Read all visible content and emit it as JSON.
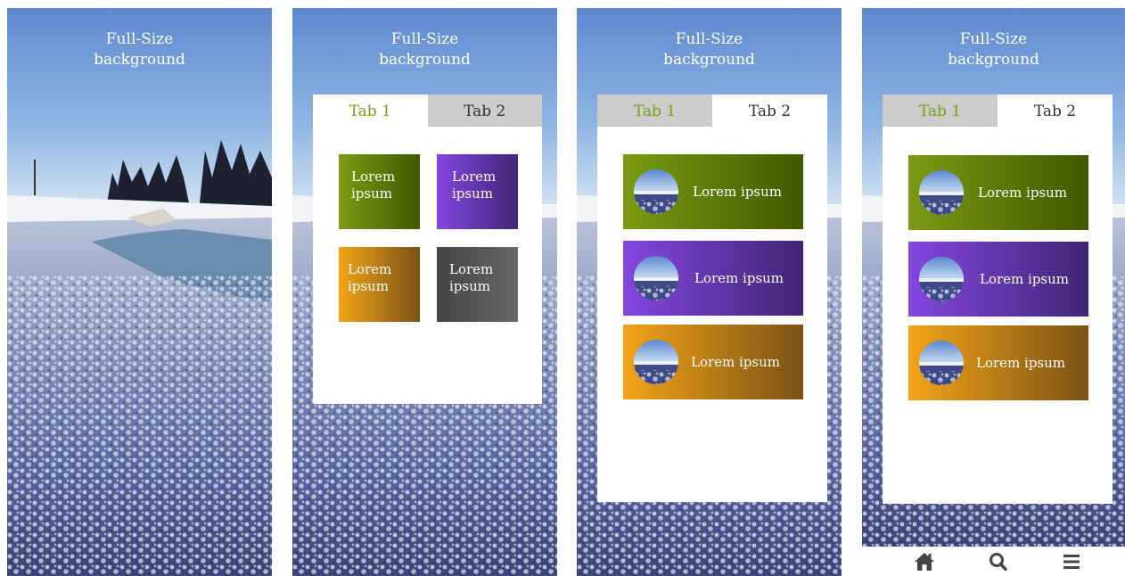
{
  "screens": [
    {
      "title_line1": "Full-Size",
      "title_line2": "background"
    },
    {
      "title_line1": "Full-Size",
      "title_line2": "background",
      "tabs": [
        "Tab 1",
        "Tab 2"
      ],
      "tiles": [
        "Lorem ipsum",
        "Lorem ipsum",
        "Lorem ipsum",
        "Lorem ipsum"
      ]
    },
    {
      "title_line1": "Full-Size",
      "title_line2": "background",
      "tabs": [
        "Tab 1",
        "Tab 2"
      ],
      "rows": [
        "Lorem ipsum",
        "Lorem ipsum",
        "Lorem ipsum"
      ]
    },
    {
      "title_line1": "Full-Size",
      "title_line2": "background",
      "tabs": [
        "Tab 1",
        "Tab 2"
      ],
      "rows": [
        "Lorem ipsum",
        "Lorem ipsum",
        "Lorem ipsum"
      ]
    }
  ],
  "nav_icons": [
    "home-icon",
    "search-icon",
    "menu-icon"
  ],
  "colors": {
    "green": "#7c9b12",
    "purple": "#8446e0",
    "orange": "#f3a417",
    "gray": "#555555",
    "tab_inactive": "#cccccc"
  }
}
